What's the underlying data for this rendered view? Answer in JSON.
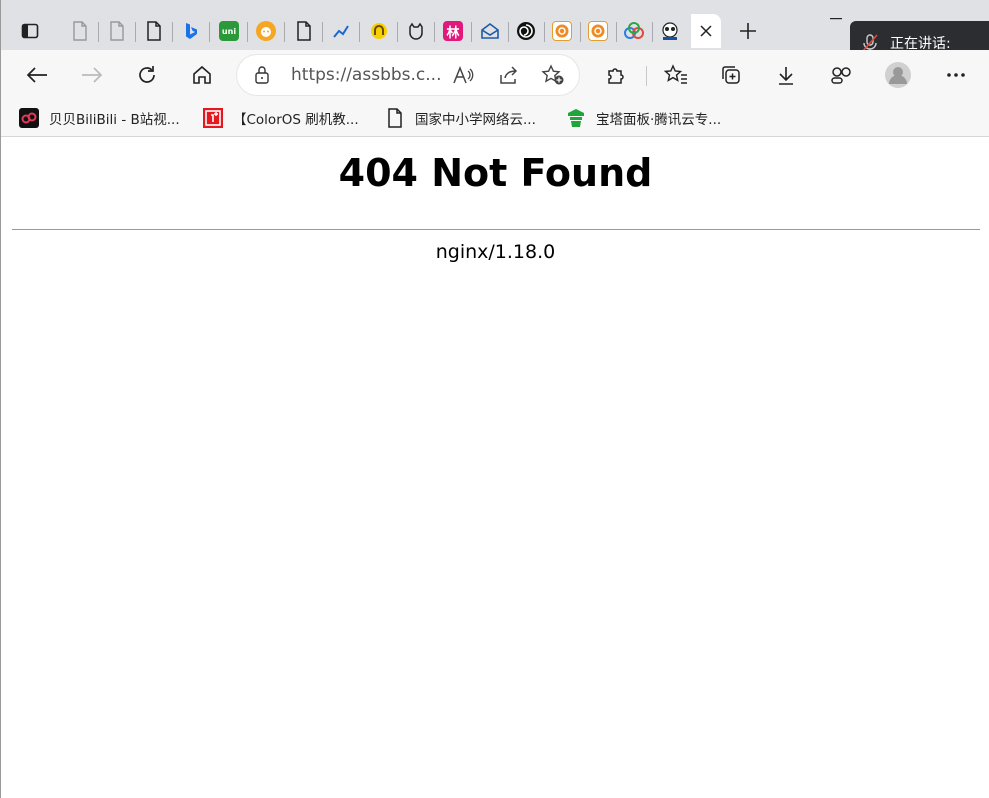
{
  "browser": {
    "omnibox": {
      "url": "https://assbbs.c..."
    },
    "talking_indicator": {
      "label": "正在讲话:"
    },
    "bookmarks": [
      {
        "label": "贝贝BiliBili - B站视...",
        "icon": "bilibili-icon"
      },
      {
        "label": "【ColorOS 刷机教...",
        "icon": "oneplus-icon"
      },
      {
        "label": "国家中小学网络云...",
        "icon": "page-icon"
      },
      {
        "label": "宝塔面板·腾讯云专...",
        "icon": "baota-icon"
      }
    ],
    "tabs": [
      {
        "icon": "page-icon"
      },
      {
        "icon": "page-icon"
      },
      {
        "icon": "page-icon"
      },
      {
        "icon": "bing-icon"
      },
      {
        "icon": "uni-icon",
        "text": "uni"
      },
      {
        "icon": "cat-icon"
      },
      {
        "icon": "page-icon"
      },
      {
        "icon": "chart-icon"
      },
      {
        "icon": "yellow-icon"
      },
      {
        "icon": "cat-outline-icon"
      },
      {
        "icon": "lin-icon",
        "text": "林"
      },
      {
        "icon": "mail-icon"
      },
      {
        "icon": "spiral-icon"
      },
      {
        "icon": "orange-icon"
      },
      {
        "icon": "orange-icon"
      },
      {
        "icon": "cloud-icon"
      },
      {
        "icon": "panda-icon"
      }
    ],
    "colors": {
      "accent": "#0067c0",
      "tabstrip": "#dfe1e5",
      "toolbar": "#f7f7f7"
    }
  },
  "page": {
    "title": "404 Not Found",
    "server": "nginx/1.18.0"
  }
}
